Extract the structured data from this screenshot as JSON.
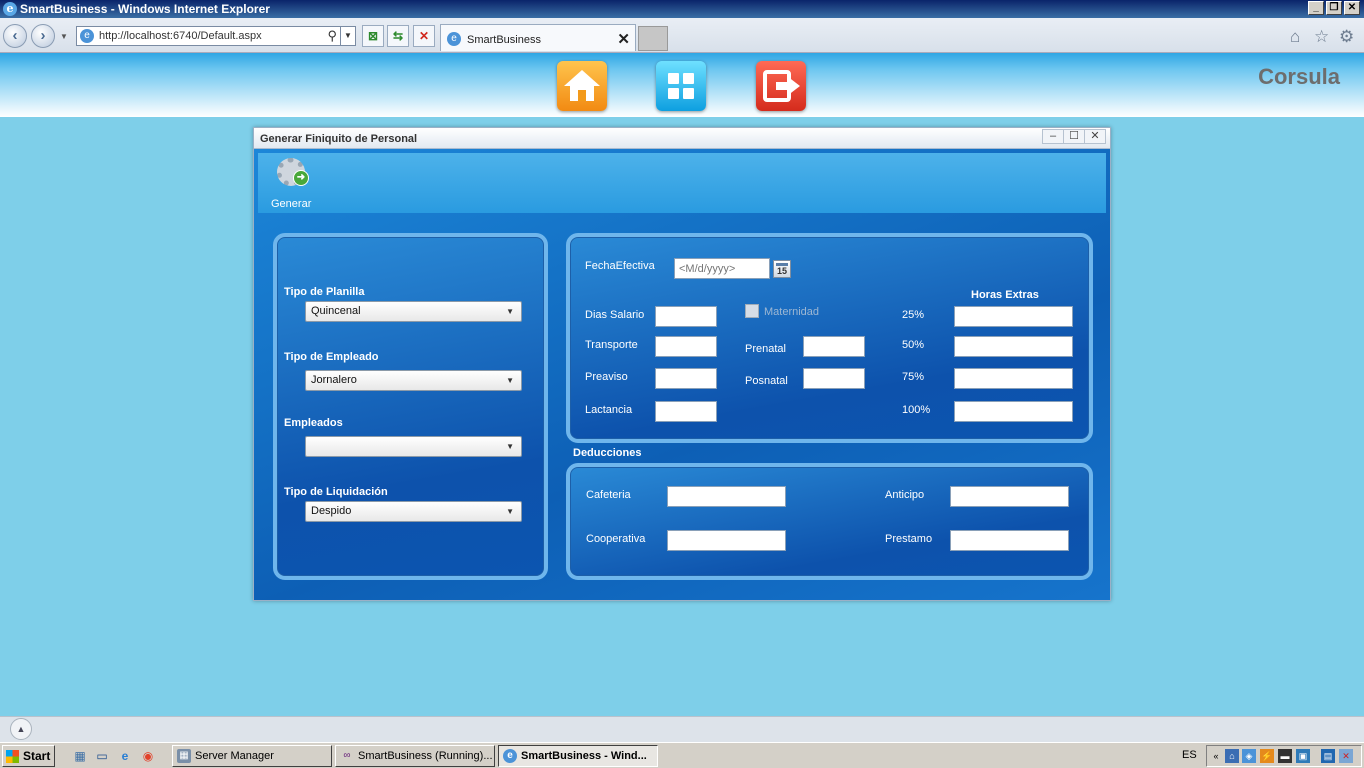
{
  "browser": {
    "window_title": "SmartBusiness - Windows Internet Explorer",
    "url": "http://localhost:6740/Default.aspx",
    "tab_label": "SmartBusiness"
  },
  "app": {
    "brand": "Corsula",
    "nav_tiles": [
      "home-icon",
      "grid-icon",
      "exit-icon"
    ],
    "tile_colors": {
      "home": "#f6a21f",
      "grid": "#18aee8",
      "exit": "#e03a26"
    }
  },
  "dialog": {
    "title": "Generar Finiquito de Personal",
    "generate_label": "Generar",
    "left_panel": {
      "tipo_planilla_label": "Tipo de Planilla",
      "tipo_planilla_value": "Quincenal",
      "tipo_empleado_label": "Tipo de Empleado",
      "tipo_empleado_value": "Jornalero",
      "empleados_label": "Empleados",
      "empleados_value": "",
      "tipo_liquidacion_label": "Tipo de Liquidación",
      "tipo_liquidacion_value": "Despido"
    },
    "main_panel": {
      "fecha_label": "FechaEfectiva",
      "fecha_placeholder": "<M/d/yyyy>",
      "calendar_day": "15",
      "dias_salario_label": "Dias Salario",
      "transporte_label": "Transporte",
      "preaviso_label": "Preaviso",
      "lactancia_label": "Lactancia",
      "maternidad_label": "Maternidad",
      "prenatal_label": "Prenatal",
      "posnatal_label": "Posnatal",
      "horas_extras_label": "Horas Extras",
      "pct_25": "25%",
      "pct_50": "50%",
      "pct_75": "75%",
      "pct_100": "100%"
    },
    "deducciones": {
      "title": "Deducciones",
      "cafeteria_label": "Cafeteria",
      "cooperativa_label": "Cooperativa",
      "anticipo_label": "Anticipo",
      "prestamo_label": "Prestamo"
    }
  },
  "taskbar": {
    "start_label": "Start",
    "items": [
      "Server Manager",
      "SmartBusiness (Running)...",
      "SmartBusiness - Wind..."
    ],
    "language": "ES"
  }
}
